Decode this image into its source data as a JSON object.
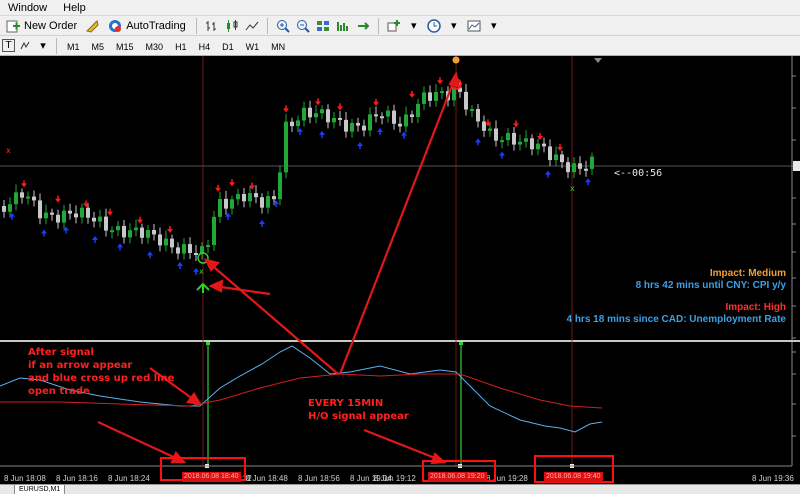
{
  "menu": [
    "Window",
    "Help"
  ],
  "toolbar": {
    "new_order": "New Order",
    "autotrading": "AutoTrading"
  },
  "timeframes": [
    "M1",
    "M5",
    "M15",
    "M30",
    "H1",
    "H4",
    "D1",
    "W1",
    "MN"
  ],
  "countdown": "<--00:56",
  "news": {
    "impact_medium": "Impact: Medium",
    "cny": "8 hrs 42 mins until CNY: CPI y/y",
    "impact_high": "Impact: High",
    "cad": "4 hrs 18 mins since CAD: Unemployment Rate"
  },
  "annotations": {
    "after_signal_1": "After signal",
    "after_signal_2": "if an arrow appear",
    "after_signal_3": "and blue cross up red line",
    "after_signal_4": "open trade",
    "every_1": "EVERY 15MIN",
    "every_2": "H/O signal appear"
  },
  "time_ticks": [
    "8 Jun 18:08",
    "8 Jun 18:16",
    "8 Jun 18:24",
    "8 Jun 18:32",
    "8 Jun 18:48",
    "8 Jun 18:56",
    "8 Jun 19:04",
    "8 Jun 19:12",
    "8 Jun 19:28",
    "8 Jun 19:36"
  ],
  "highlight_labels": [
    "2018.06.08 18:40",
    "2018.06.08 19:20",
    "2018.06.08 19:40"
  ],
  "symbol_tab": "EURUSD,M1",
  "colors": {
    "bull": "#21a838",
    "bear": "#c8c8c8",
    "up_arrow": "#1a3cff",
    "down_arrow": "#ff1a1a",
    "vline": "#8a2020",
    "annotation": "#ff2020",
    "blue_line": "#5ab0f0",
    "red_line": "#d02020"
  }
}
